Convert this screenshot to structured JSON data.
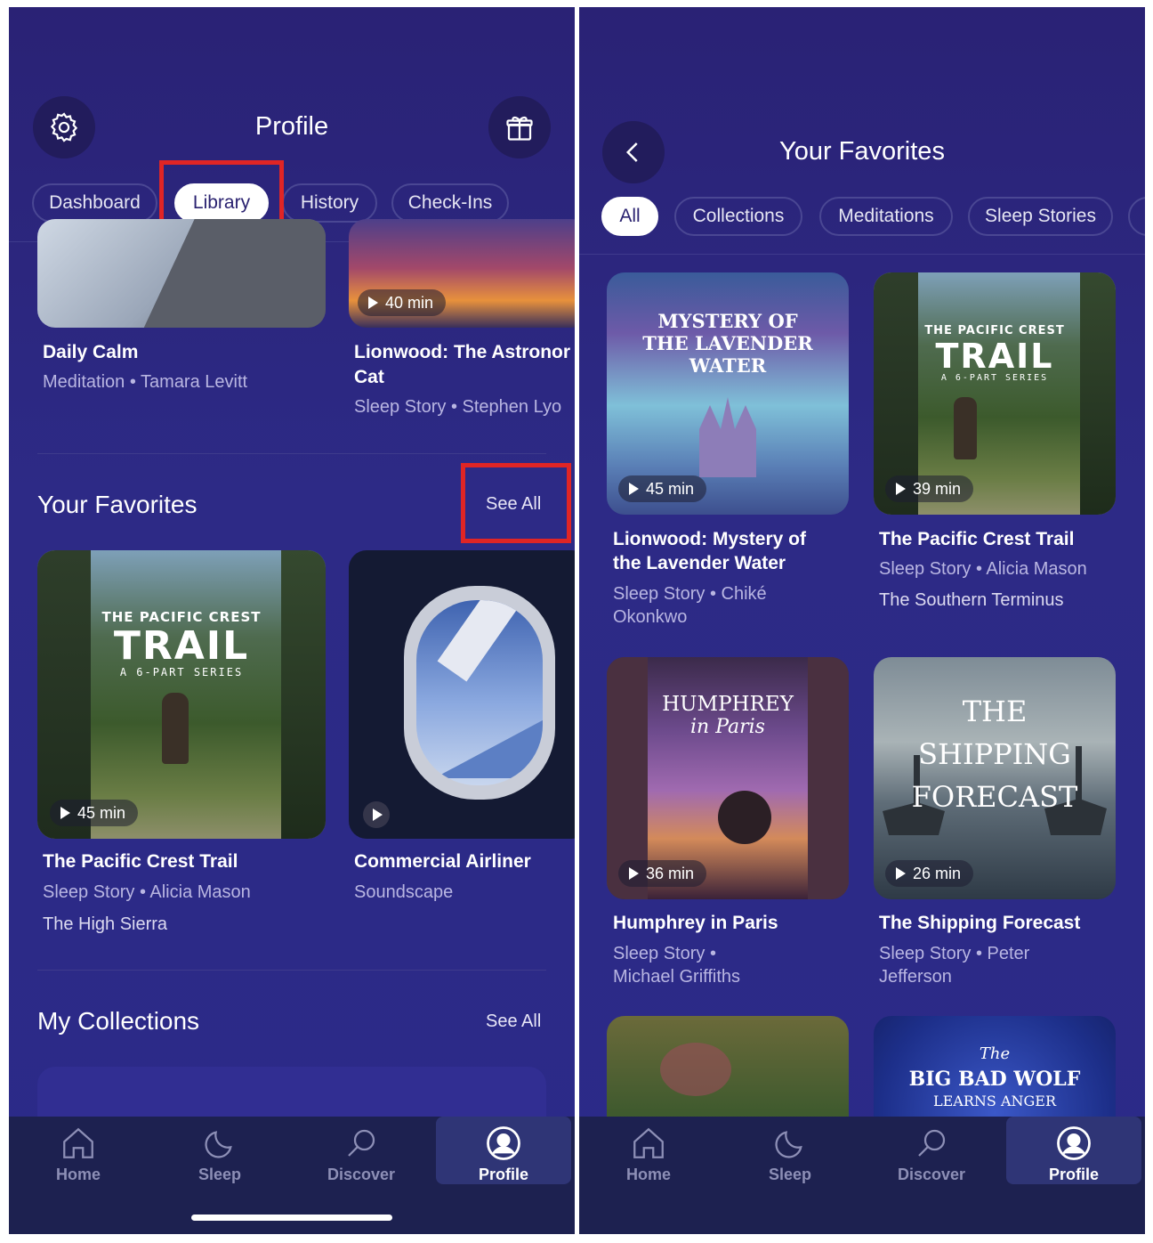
{
  "left": {
    "title": "Profile",
    "tabs": [
      {
        "label": "Dashboard"
      },
      {
        "label": "Library"
      },
      {
        "label": "History"
      },
      {
        "label": "Check-Ins"
      }
    ],
    "top_cards": [
      {
        "title": "Daily Calm",
        "subtitle": "Meditation • Tamara Levitt"
      },
      {
        "title": "Lionwood: The Astronomer's Cat",
        "title_line1": "Lionwood: The Astronor",
        "title_line2": "Cat",
        "subtitle": "Sleep Story • Stephen Lyo",
        "duration": "40 min"
      }
    ],
    "favorites": {
      "title": "Your Favorites",
      "see_all": "See All",
      "cards": [
        {
          "title": "The Pacific Crest Trail",
          "subtitle": "Sleep Story • Alicia Mason",
          "episode": "The High Sierra",
          "duration": "45 min",
          "art": {
            "top": "THE PACIFIC CREST",
            "main": "TRAIL",
            "bottom": "A 6-PART SERIES"
          }
        },
        {
          "title": "Commercial Airliner",
          "subtitle": "Soundscape"
        }
      ]
    },
    "collections": {
      "title": "My Collections",
      "see_all": "See All"
    }
  },
  "right": {
    "title": "Your Favorites",
    "filters": [
      {
        "label": "All"
      },
      {
        "label": "Collections"
      },
      {
        "label": "Meditations"
      },
      {
        "label": "Sleep Stories"
      }
    ],
    "cards": [
      {
        "title_line1": "Lionwood: Mystery of",
        "title_line2": "the Lavender Water",
        "sub_line1": "Sleep Story • Chiké",
        "sub_line2": "Okonkwo",
        "duration": "45 min",
        "art": {
          "l1": "MYSTERY OF",
          "l2": "THE LAVENDER",
          "l3": "WATER"
        }
      },
      {
        "title_line1": "The Pacific Crest Trail",
        "sub_line1": "Sleep Story • Alicia Mason",
        "sub_line2": "The Southern Terminus",
        "duration": "39 min",
        "art": {
          "top": "THE PACIFIC CREST",
          "main": "TRAIL",
          "bottom": "A 6-PART SERIES"
        }
      },
      {
        "title_line1": "Humphrey in Paris",
        "sub_line1": "Sleep Story •",
        "sub_line2": "Michael Griffiths",
        "duration": "36 min",
        "art": {
          "l1": "HUMPHREY",
          "l2": "in Paris"
        }
      },
      {
        "title_line1": "The Shipping Forecast",
        "sub_line1": "Sleep Story • Peter",
        "sub_line2": "Jefferson",
        "duration": "26 min",
        "art": {
          "l1": "THE",
          "l2": "SHIPPING",
          "l3": "FORECAST"
        }
      },
      {
        "art": {}
      },
      {
        "art": {
          "l1": "The",
          "l2": "BIG BAD WOLF",
          "l3": "LEARNS ANGER"
        }
      }
    ]
  },
  "nav": [
    {
      "label": "Home",
      "icon": "home-icon"
    },
    {
      "label": "Sleep",
      "icon": "moon-icon"
    },
    {
      "label": "Discover",
      "icon": "search-icon"
    },
    {
      "label": "Profile",
      "icon": "profile-icon"
    }
  ],
  "colors": {
    "background": "#2b2a88",
    "navbar": "#1d2150",
    "highlight": "#e02525"
  }
}
